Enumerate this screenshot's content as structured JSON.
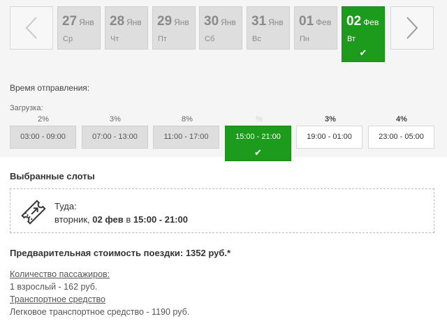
{
  "dates": [
    {
      "day": "27",
      "month": "Янв",
      "weekday": "Ср"
    },
    {
      "day": "28",
      "month": "Янв",
      "weekday": "Чт"
    },
    {
      "day": "29",
      "month": "Янв",
      "weekday": "Пт"
    },
    {
      "day": "30",
      "month": "Янв",
      "weekday": "Сб"
    },
    {
      "day": "31",
      "month": "Янв",
      "weekday": "Вс"
    },
    {
      "day": "01",
      "month": "Фев",
      "weekday": "Пн"
    },
    {
      "day": "02",
      "month": "Фев",
      "weekday": "Вт"
    }
  ],
  "check_glyph": "✔",
  "departure_label": "Время отправления:",
  "load_label": "Загрузка:",
  "slots": [
    {
      "time": "03:00 - 09:00",
      "load": "2%"
    },
    {
      "time": "07:00 - 13:00",
      "load": "3%"
    },
    {
      "time": "11:00 - 17:00",
      "load": "8%"
    },
    {
      "time": "15:00 - 21:00",
      "load": "%"
    },
    {
      "time": "19:00 - 01:00",
      "load": "3%"
    },
    {
      "time": "23:00 - 05:00",
      "load": "4%"
    }
  ],
  "selected": {
    "title": "Выбранные слоты",
    "direction": "Туда:",
    "weekday": "вторник,",
    "date": "02 фев",
    "in_word": "в",
    "time": "15:00 - 21:00"
  },
  "cost": {
    "title": "Предварительная стоимость поездки: 1352 руб.*",
    "passengers_label": "Количество пассажиров:",
    "passengers_value": "1 взрослый - 162 руб.",
    "vehicle_label": "Транспортное средство",
    "vehicle_value": "Легковое транспортное средство - 1190 руб."
  },
  "colors": {
    "accent": "#1c9b1c",
    "inactive": "#dedede",
    "panel": "#f5f5f5"
  },
  "icons": {
    "prev": "chevron-left-icon",
    "next": "chevron-right-icon",
    "ticket": "ticket-icon",
    "check": "check-icon"
  }
}
